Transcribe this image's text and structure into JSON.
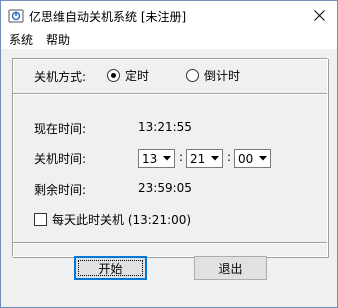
{
  "window": {
    "title": "亿思维自动关机系统 [未注册]",
    "close_symbol": "✕"
  },
  "menu": {
    "items": [
      {
        "label": "系统"
      },
      {
        "label": "帮助"
      }
    ]
  },
  "shutdown_mode": {
    "label": "关机方式:",
    "options": [
      {
        "label": "定时",
        "selected": true
      },
      {
        "label": "倒计时",
        "selected": false
      }
    ]
  },
  "current_time": {
    "label": "现在时间:",
    "value": "13:21:55"
  },
  "shutdown_time": {
    "label": "关机时间:",
    "hour": "13",
    "minute": "21",
    "second": "00",
    "separator": ":"
  },
  "remaining_time": {
    "label": "剩余时间:",
    "value": "23:59:05"
  },
  "daily_option": {
    "label": "每天此时关机 (13:21:00)",
    "checked": false
  },
  "buttons": {
    "start_label": "开始",
    "exit_label": "退出"
  },
  "colors": {
    "frame_border": "#6d8fb8",
    "client_bg": "#f0f0f0",
    "default_button_border": "#0078d7"
  }
}
